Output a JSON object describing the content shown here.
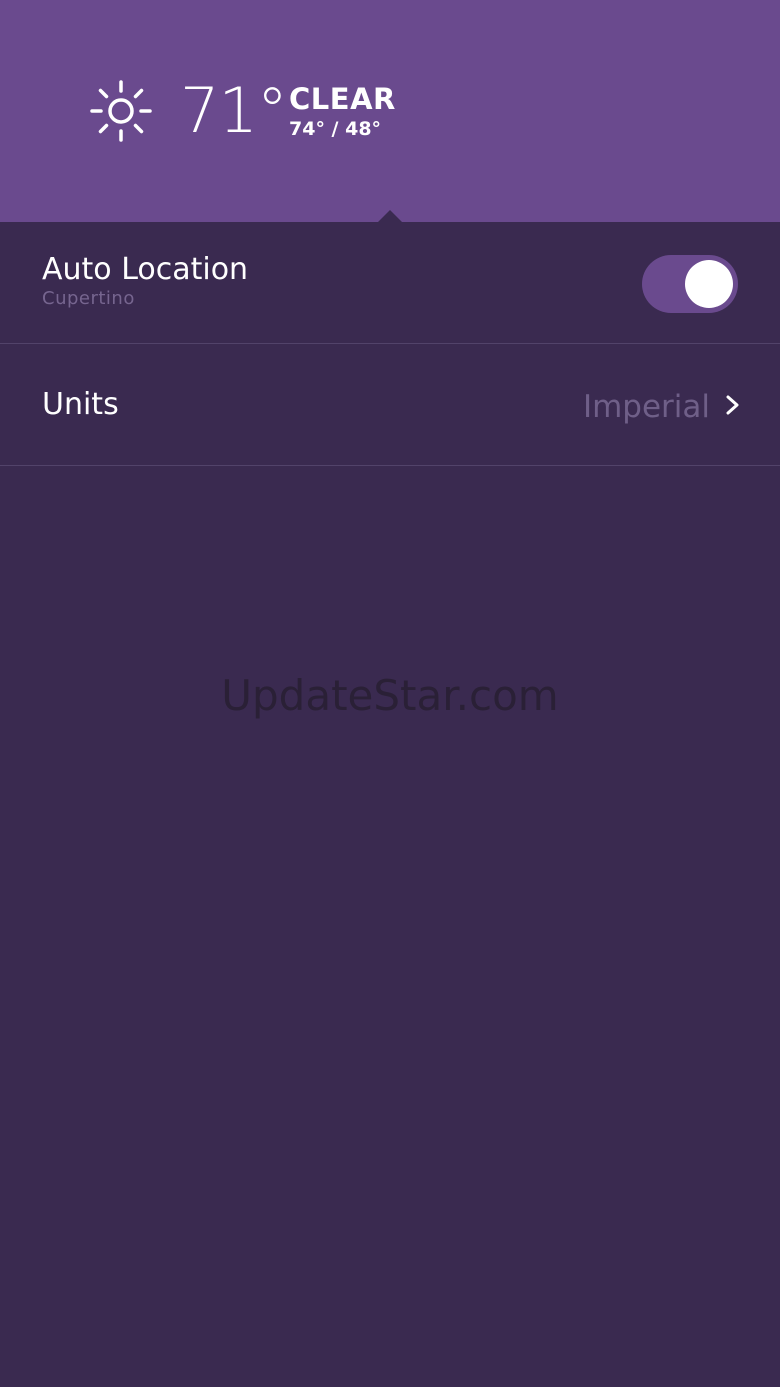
{
  "weather": {
    "icon": "sun-icon",
    "temperature": "71°",
    "condition": "CLEAR",
    "high_low": "74° / 48°"
  },
  "settings": {
    "auto_location": {
      "label": "Auto Location",
      "sublabel": "Cupertino",
      "enabled": true
    },
    "units": {
      "label": "Units",
      "value": "Imperial",
      "icon": "chevron-right-icon"
    }
  },
  "watermark": "UpdateStar.com",
  "colors": {
    "header_bg": "#6a4a8e",
    "page_bg": "#3a2a50",
    "toggle_on": "#6a4a8e",
    "muted_text": "#6f5f88"
  }
}
